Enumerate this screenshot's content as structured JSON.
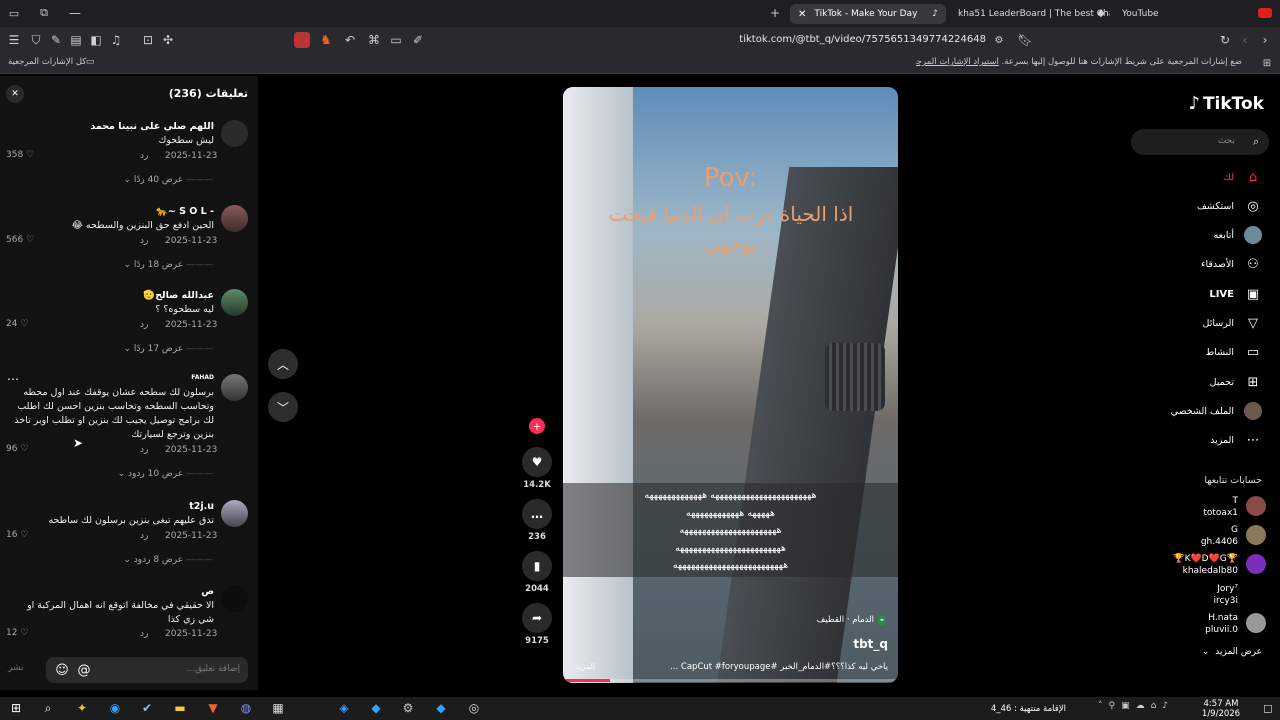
{
  "browser": {
    "tabs": [
      {
        "label": "TikTok - Make Your Day"
      },
      {
        "label": "kha51 LeaderBoard | The best ChatBo"
      },
      {
        "label": "YouTube"
      }
    ],
    "url": "tiktok.com/@tbt_q/video/7575651349774224648",
    "bookmark_hint": "ضع إشارات المرجعية على شريط الإشارات هنا للوصول إليها بسرعة.",
    "bookmark_import": "استيراد الإشارات المرجعية الآن...",
    "all_bookmarks": "كل الإشارات المرجعية"
  },
  "comments_panel": {
    "title": "تعليقات (236)",
    "reply_label": "رد",
    "items": [
      {
        "name": "اللهم صلي على نبينا محمد",
        "text": "ليش سطحوك",
        "date": "2025-11-23",
        "likes": "358",
        "replies": "عرض 40 ردًا"
      },
      {
        "name": "- S O L ~🐆",
        "text": "الحين ادفع حق البنزين والسطحه 😂",
        "date": "2025-11-23",
        "likes": "566",
        "replies": "عرض 18 ردًا"
      },
      {
        "name": "عبدالله صالح🫡",
        "text": "ليه سطحوه؟ ؟",
        "date": "2025-11-23",
        "likes": "24",
        "replies": "عرض 17 ردًا"
      },
      {
        "name": "FAHAD",
        "text": "برسلون لك سطحه عشان يوقفك عند اول محطه وتحاسب السطحه وتحاسب بنزين احسن لك اطلب لك برامج توصيل يجيب لك بنزين او تطلب اوبر تاخذ بنزين وترجع لسيارتك",
        "date": "2025-11-23",
        "likes": "96",
        "replies": "عرض 10 ردود"
      },
      {
        "name": "t2j.u",
        "text": "تدق عليهم تبغى بنزين برسلون لك ساطحه",
        "date": "2025-11-23",
        "likes": "16",
        "replies": "عرض 8 ردود"
      },
      {
        "name": "ص",
        "text": "الا حقيقي في مخالفة اتوقع انه اهمال المركبة او شي زي كذا",
        "date": "2025-11-23",
        "likes": "12",
        "replies": ""
      }
    ],
    "input_placeholder": "إضافة تعليق...",
    "post_label": "نشر"
  },
  "video": {
    "overlay_title": "Pov:",
    "overlay_text": "اذا الحياة درت ان الدنيا فتحت بوجهي",
    "caption_lines": [
      "هههههههههههههههههههههههه هههههههههههههه",
      "هههههه ههههههههههههه",
      "ههههههههههههههههههههههه",
      "ههههههههههههههههههههههههه",
      "هههههههههههههههههههههههههه"
    ],
    "location": "الدمام · القطيف",
    "author": "tbt_q",
    "description": "ياخي ليه كذا؟؟؟#الدمام_الخبر #CapCut #foryoupage ...",
    "more_label": "المزيد",
    "progress": 0.14
  },
  "actions": {
    "likes": "14.2K",
    "comments": "236",
    "saves": "2044",
    "shares": "9175"
  },
  "sidebar": {
    "logo": "TikTok",
    "search_placeholder": "بحث",
    "nav": [
      {
        "label": "لك",
        "icon": "home-icon"
      },
      {
        "label": "استكشف",
        "icon": "compass-icon"
      },
      {
        "label": "أتابعه",
        "icon": "avatar-icon"
      },
      {
        "label": "الأصدقاء",
        "icon": "friends-icon"
      },
      {
        "label": "LIVE",
        "icon": "live-icon"
      },
      {
        "label": "الرسائل",
        "icon": "send-icon"
      },
      {
        "label": "النشاط",
        "icon": "activity-icon"
      },
      {
        "label": "تحميل",
        "icon": "upload-icon"
      },
      {
        "label": "الملف الشخصي",
        "icon": "profile-icon"
      },
      {
        "label": "المزيد",
        "icon": "more-icon"
      }
    ],
    "following_title": "حسابات تتابعها",
    "following": [
      {
        "name": "T",
        "handle": "totoax1"
      },
      {
        "name": "G",
        "handle": "gh.4406"
      },
      {
        "name": "🏆K❤️D❤️G🏆",
        "handle": "khaledalb80"
      },
      {
        "name": "Jory⁷",
        "handle": "ircy3i"
      },
      {
        "name": "H.nata",
        "handle": "pluvii.0"
      }
    ],
    "see_more": "عرض المزيد"
  },
  "taskbar": {
    "time": "4:57 AM",
    "date": "1/9/2026",
    "notice": "الإقامة منتهية : 46_4"
  },
  "colors": {
    "accent": "#fe2c55",
    "panel": "#121212"
  }
}
